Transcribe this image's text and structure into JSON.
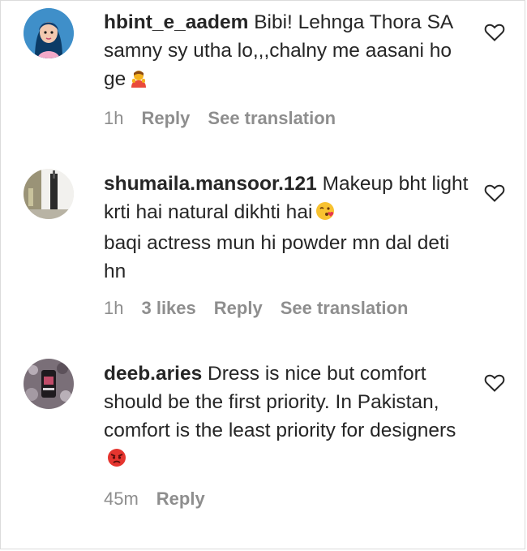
{
  "comments": [
    {
      "username": "hbint_e_aadem",
      "text": "Bibi! Lehnga Thora SA samny sy utha lo,,,chalny me aasani ho ge",
      "emoji": "person-bowing-emoji",
      "time": "1h",
      "likes": "",
      "reply": "Reply",
      "translate": "See translation"
    },
    {
      "username": "shumaila.mansoor.121",
      "text": "Makeup bht light krti hai natural dikhti hai",
      "text2": "baqi actress mun hi powder mn dal deti hn",
      "emoji": "face-blowing-kiss-emoji",
      "time": "1h",
      "likes": "3 likes",
      "reply": "Reply",
      "translate": "See translation"
    },
    {
      "username": "deeb.aries",
      "text": "Dress is nice but comfort should be the first priority. In Pakistan, comfort is the least priority for designers",
      "emoji": "angry-face-emoji",
      "time": "45m",
      "reply": "Reply"
    }
  ],
  "colors": {
    "text": "#262626",
    "meta": "#8e8e8e",
    "border": "#dbdbdb"
  }
}
